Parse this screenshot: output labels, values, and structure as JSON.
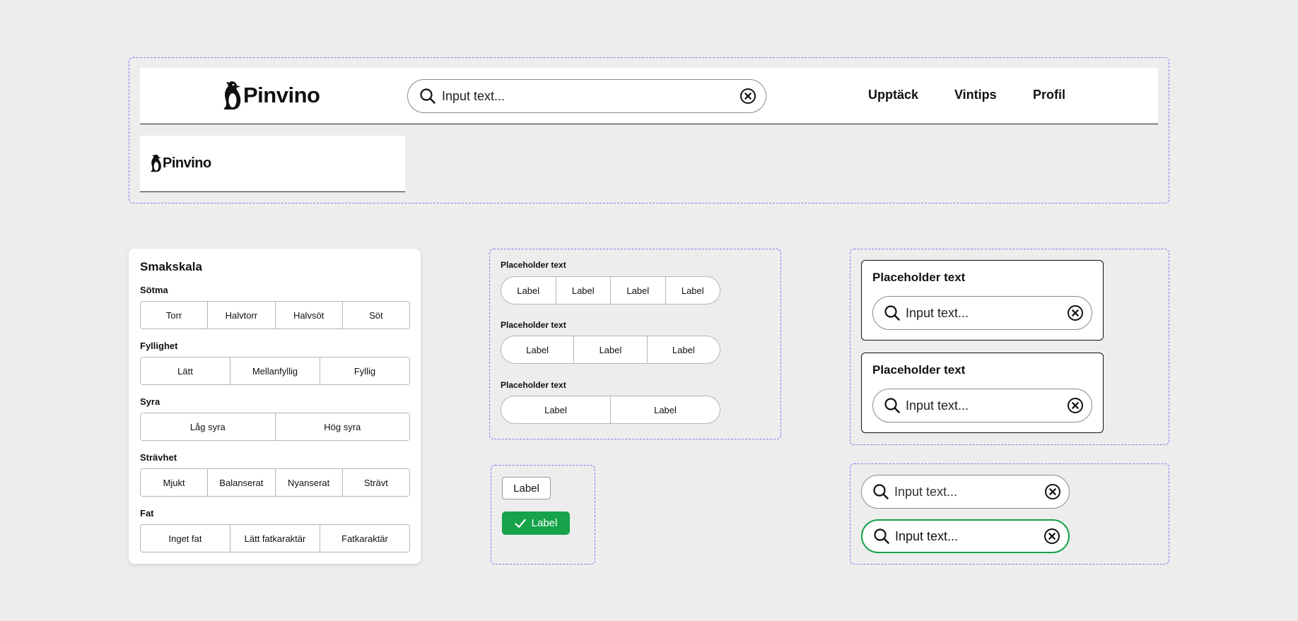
{
  "header": {
    "logo_text": "Pinvino",
    "search_placeholder": "Input text...",
    "nav": [
      "Upptäck",
      "Vintips",
      "Profil"
    ]
  },
  "mini_header": {
    "logo_text": "Pinvino"
  },
  "smakskala": {
    "title": "Smakskala",
    "groups": [
      {
        "label": "Sötma",
        "options": [
          "Torr",
          "Halvtorr",
          "Halvsöt",
          "Söt"
        ]
      },
      {
        "label": "Fyllighet",
        "options": [
          "Lätt",
          "Mellanfyllig",
          "Fyllig"
        ]
      },
      {
        "label": "Syra",
        "options": [
          "Låg syra",
          "Hög syra"
        ]
      },
      {
        "label": "Strävhet",
        "options": [
          "Mjukt",
          "Balanserat",
          "Nyanserat",
          "Strävt"
        ]
      },
      {
        "label": "Fat",
        "options": [
          "Inget fat",
          "Lätt fatkaraktär",
          "Fatkaraktär"
        ]
      }
    ]
  },
  "pill_groups": [
    {
      "label": "Placeholder text",
      "options": [
        "Label",
        "Label",
        "Label",
        "Label"
      ]
    },
    {
      "label": "Placeholder text",
      "options": [
        "Label",
        "Label",
        "Label"
      ]
    },
    {
      "label": "Placeholder text",
      "options": [
        "Label",
        "Label"
      ]
    }
  ],
  "chips": {
    "outline_label": "Label",
    "selected_label": "Label",
    "selected_color": "#16a34a"
  },
  "search_cards": [
    {
      "title": "Placeholder text",
      "input_text": "Input text..."
    },
    {
      "title": "Placeholder text",
      "input_text": "Input text..."
    }
  ],
  "search_fields": [
    {
      "input_text": "Input text...",
      "state": "default",
      "border_color": "#8a8a8a"
    },
    {
      "input_text": "Input text...",
      "state": "focused",
      "border_color": "#16a34a"
    }
  ]
}
